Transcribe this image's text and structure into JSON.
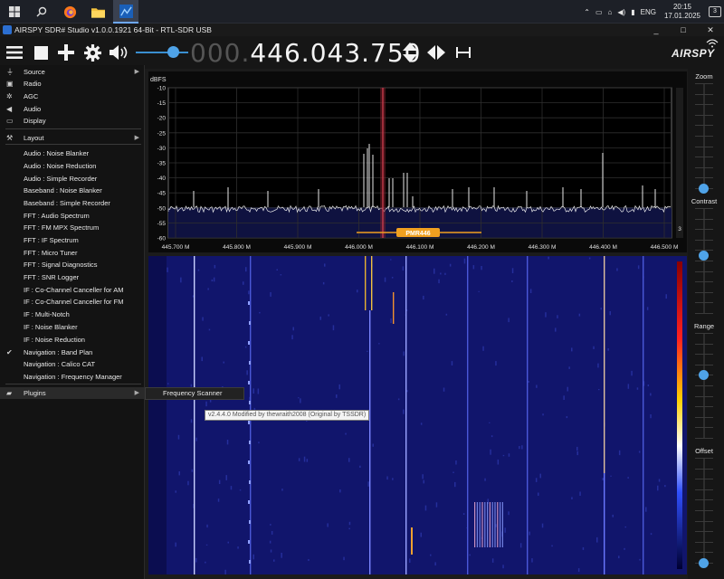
{
  "taskbar": {
    "apps": [
      "windows-icon",
      "search-icon",
      "firefox-icon",
      "file-explorer-icon",
      "sdr-sharp-icon"
    ],
    "tray": {
      "language": "ENG",
      "time": "20:15",
      "date": "17.01.2025",
      "notifications": "3"
    }
  },
  "window": {
    "title": "AIRSPY SDR# Studio v1.0.0.1921 64-Bit - RTL-SDR USB",
    "controls": [
      "_",
      "□",
      "✕"
    ]
  },
  "toolbar": {
    "frequency_dim": "000.",
    "frequency": "446.043.750",
    "brand": "AIRSPY",
    "volume": 0.75
  },
  "menu": {
    "items": [
      {
        "label": "Source",
        "icon": "plug-icon",
        "submenu": true
      },
      {
        "label": "Radio",
        "icon": "radio-icon"
      },
      {
        "label": "AGC",
        "icon": "gears-icon"
      },
      {
        "label": "Audio",
        "icon": "speaker-icon"
      },
      {
        "label": "Display",
        "icon": "monitor-icon"
      },
      {
        "label": "Layout",
        "icon": "wrench-icon",
        "submenu": true
      },
      {
        "label": "Audio : Noise Blanker"
      },
      {
        "label": "Audio : Noise Reduction"
      },
      {
        "label": "Audio : Simple Recorder"
      },
      {
        "label": "Baseband : Noise Blanker"
      },
      {
        "label": "Baseband : Simple Recorder"
      },
      {
        "label": "FFT : Audio Spectrum"
      },
      {
        "label": "FFT : FM MPX Spectrum"
      },
      {
        "label": "FFT : IF Spectrum"
      },
      {
        "label": "FFT : Micro Tuner"
      },
      {
        "label": "FFT : Signal Diagnostics"
      },
      {
        "label": "FFT : SNR Logger"
      },
      {
        "label": "IF : Co-Channel Canceller for AM"
      },
      {
        "label": "IF : Co-Channel Canceller for FM"
      },
      {
        "label": "IF : Multi-Notch"
      },
      {
        "label": "IF : Noise Blanker"
      },
      {
        "label": "IF : Noise Reduction"
      },
      {
        "label": "Navigation : Band Plan",
        "checked": true
      },
      {
        "label": "Navigation : Calico CAT"
      },
      {
        "label": "Navigation : Frequency Manager"
      },
      {
        "label": "Plugins",
        "icon": "plugin-icon",
        "submenu": true
      }
    ],
    "submenu_item": "Frequency Scanner",
    "tooltip": "v2.4.4.0 Modified by thewraith2008 (Original by TSSDR)"
  },
  "spectrum": {
    "y_unit": "dBFS",
    "y_ticks": [
      "-10",
      "-15",
      "-20",
      "-25",
      "-30",
      "-35",
      "-40",
      "-45",
      "-50",
      "-55",
      "-60"
    ],
    "x_ticks": [
      "445.700 M",
      "445.800 M",
      "445.900 M",
      "446.000 M",
      "446.100 M",
      "446.200 M",
      "446.300 M",
      "446.400 M",
      "446.500 M"
    ],
    "band_label": "PMR446",
    "scale_value": "3"
  },
  "sidepanel": {
    "zoom_label": "Zoom",
    "contrast_label": "Contrast",
    "range_label": "Range",
    "offset_label": "Offset",
    "zoom_level": 0.0,
    "contrast_level": 0.55,
    "range_level": 0.6,
    "offset_level": 0.0
  }
}
